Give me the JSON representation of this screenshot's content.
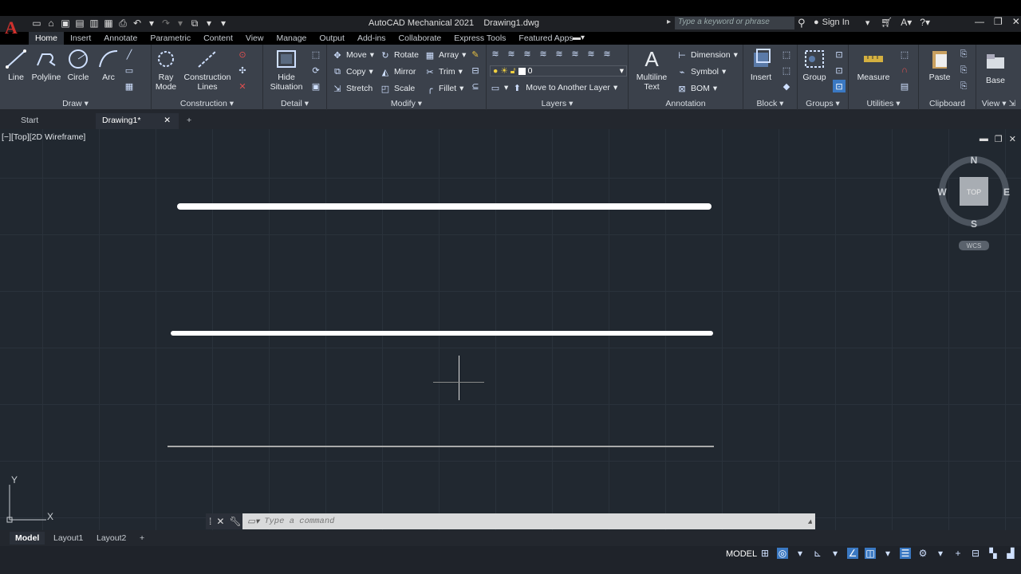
{
  "app": {
    "title": "AutoCAD Mechanical 2021",
    "file": "Drawing1.dwg",
    "search_placeholder": "Type a keyword or phrase",
    "sign_in": "Sign In"
  },
  "ribbon_tabs": [
    "Home",
    "Insert",
    "Annotate",
    "Parametric",
    "Content",
    "View",
    "Manage",
    "Output",
    "Add-ins",
    "Collaborate",
    "Express Tools",
    "Featured Apps"
  ],
  "panels": {
    "draw": {
      "title": "Draw",
      "line": "Line",
      "polyline": "Polyline",
      "circle": "Circle",
      "arc": "Arc"
    },
    "construction": {
      "title": "Construction",
      "ray": "Ray",
      "ray2": "Mode",
      "cl1": "Construction",
      "cl2": "Lines"
    },
    "detail": {
      "title": "Detail",
      "hide1": "Hide",
      "hide2": "Situation"
    },
    "modify": {
      "title": "Modify",
      "move": "Move",
      "rotate": "Rotate",
      "array": "Array",
      "copy": "Copy",
      "mirror": "Mirror",
      "trim": "Trim",
      "stretch": "Stretch",
      "scale": "Scale",
      "fillet": "Fillet"
    },
    "layers": {
      "title": "Layers",
      "current_layer": "0",
      "move_to_layer": "Move to Another Layer"
    },
    "annotation": {
      "title": "Annotation",
      "mtext1": "Multiline",
      "mtext2": "Text",
      "dimension": "Dimension",
      "symbol": "Symbol",
      "bom": "BOM"
    },
    "block": {
      "title": "Block",
      "insert": "Insert"
    },
    "groups": {
      "title": "Groups",
      "group": "Group"
    },
    "utilities": {
      "title": "Utilities",
      "measure": "Measure"
    },
    "clipboard": {
      "title": "Clipboard",
      "paste": "Paste"
    },
    "view": {
      "title": "View",
      "base": "Base"
    }
  },
  "doc_tabs": {
    "start": "Start",
    "drawing": "Drawing1*"
  },
  "viewport": {
    "label": "[−][Top][2D Wireframe]",
    "viewcube": {
      "n": "N",
      "s": "S",
      "e": "E",
      "w": "W",
      "face": "TOP",
      "wcs": "WCS"
    },
    "ucs": {
      "x": "X",
      "y": "Y"
    }
  },
  "command": {
    "placeholder": "Type a command"
  },
  "layout_tabs": [
    "Model",
    "Layout1",
    "Layout2"
  ],
  "status": {
    "model": "MODEL"
  }
}
